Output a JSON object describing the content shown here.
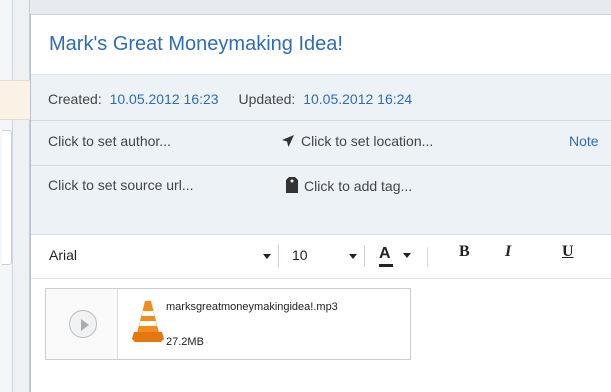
{
  "note": {
    "title": "Mark's Great Moneymaking Idea!",
    "created_label": "Created:",
    "created_value": "10.05.2012 16:23",
    "updated_label": "Updated:",
    "updated_value": "10.05.2012 16:24",
    "author_placeholder": "Click to set author...",
    "location_placeholder": "Click to set location...",
    "notebook_link": "Note",
    "source_placeholder": "Click to set source url...",
    "tag_placeholder": "Click to add tag..."
  },
  "toolbar": {
    "font_family": "Arial",
    "font_size": "10",
    "color_label": "A",
    "bold_label": "B",
    "italic_label": "I",
    "underline_label": "U"
  },
  "attachment": {
    "file_name": "marksgreatmoneymakingidea!.mp3",
    "file_size": "27.2MB",
    "icon": "vlc-cone-icon"
  },
  "colors": {
    "accent": "#2f6db0",
    "meta_bg": "#edf2f7",
    "vlc_orange": "#f28c1c"
  }
}
